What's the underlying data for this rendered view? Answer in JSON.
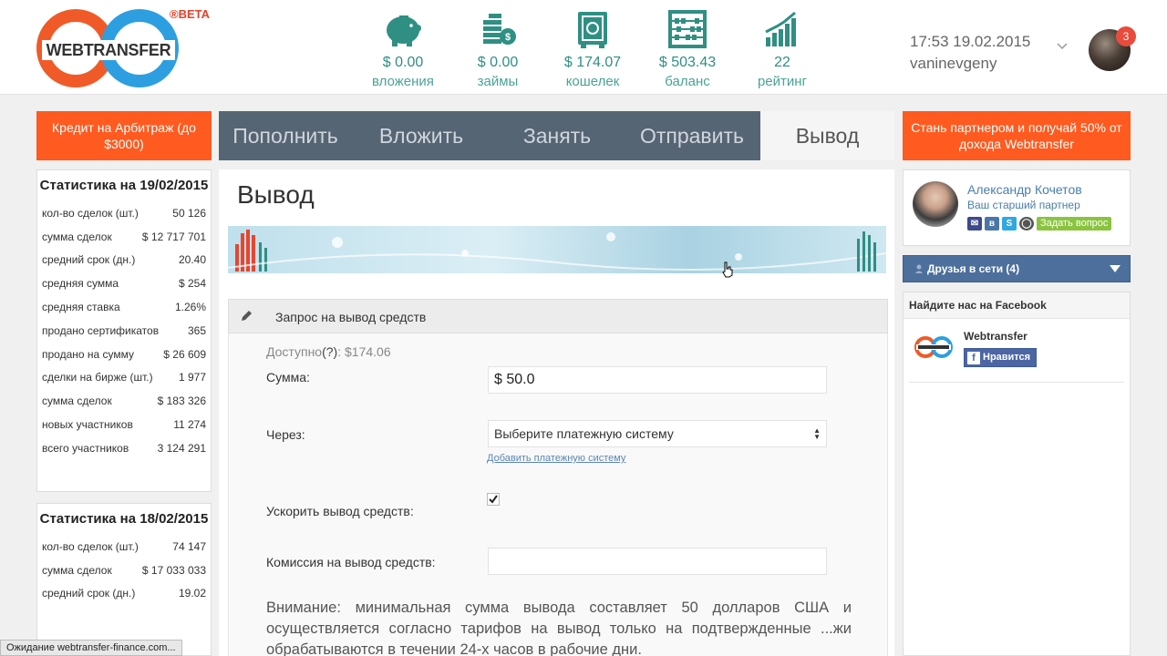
{
  "brand": {
    "logo_text": "WEBTRANSFER",
    "beta": "®BETA"
  },
  "header_stats": [
    {
      "icon": "piggy-bank-icon",
      "value": "$ 0.00",
      "label": "вложения"
    },
    {
      "icon": "coins-icon",
      "value": "$ 0.00",
      "label": "займы"
    },
    {
      "icon": "safe-icon",
      "value": "$ 174.07",
      "label": "кошелек"
    },
    {
      "icon": "abacus-icon",
      "value": "$ 503.43",
      "label": "баланс"
    },
    {
      "icon": "rating-chart-icon",
      "value": "22",
      "label": "рейтинг"
    }
  ],
  "user": {
    "datetime": "17:53 19.02.2015",
    "username": "vaninevgeny",
    "notifications": "3"
  },
  "left_promo": "Кредит на Арбитраж (до $3000)",
  "right_promo": "Стань партнером и получай 50% от дохода Webtransfer",
  "stats_today": {
    "title": "Статистика на 19/02/2015",
    "rows": [
      {
        "label": "кол-во сделок (шт.)",
        "value": "50 126"
      },
      {
        "label": "сумма сделок",
        "value": "$ 12 717 701"
      },
      {
        "label": "средний срок (дн.)",
        "value": "20.40"
      },
      {
        "label": "средняя сумма",
        "value": "$ 254"
      },
      {
        "label": "средняя ставка",
        "value": "1.26%"
      },
      {
        "label": "продано сертификатов",
        "value": "365"
      },
      {
        "label": "продано на сумму",
        "value": "$ 26 609"
      },
      {
        "label": "сделки на бирже (шт.)",
        "value": "1 977"
      },
      {
        "label": "сумма сделок",
        "value": "$ 183 326"
      },
      {
        "label": "новых участников",
        "value": "11 274"
      },
      {
        "label": "всего участников",
        "value": "3 124 291"
      }
    ]
  },
  "stats_yesterday": {
    "title": "Статистика на 18/02/2015",
    "rows": [
      {
        "label": "кол-во сделок (шт.)",
        "value": "74 147"
      },
      {
        "label": "сумма сделок",
        "value": "$ 17 033 033"
      },
      {
        "label": "средний срок (дн.)",
        "value": "19.02"
      }
    ]
  },
  "tabs": [
    {
      "label": "Пополнить",
      "active": false
    },
    {
      "label": "Вложить",
      "active": false
    },
    {
      "label": "Занять",
      "active": false
    },
    {
      "label": "Отправить",
      "active": false
    },
    {
      "label": "Вывод",
      "active": true
    }
  ],
  "page": {
    "title": "Вывод",
    "form_title": "Запрос на вывод средств",
    "available_label": "Доступно",
    "available_hint": "(?)",
    "available_value": ":  $174.06",
    "amount_label": "Сумма:",
    "amount_value": "$ 50.0",
    "via_label": "Через:",
    "via_selected": "Выберите платежную систему",
    "add_system_link": "Добавить платежную систему",
    "speedup_label": "Ускорить вывод средств:",
    "speedup_checked": true,
    "commission_label": "Комиссия на вывод средств:",
    "commission_value": "",
    "notice": "Внимание: минимальная сумма вывода составляет 50 долларов США и осуществляется согласно тарифов на вывод только на подтвержденные ...жи обрабатываются в течении 24-х часов в рабочие дни."
  },
  "partner": {
    "name": "Александр Кочетов",
    "role": "Ваш старший партнер",
    "icons": [
      "email-icon",
      "vk-icon",
      "skype-icon",
      "odnoklassniki-icon"
    ],
    "ask_button": "Задать вопрос"
  },
  "friends": {
    "label": "Друзья в сети (4)"
  },
  "facebook": {
    "header": "Найдите нас на Facebook",
    "page_name": "Webtransfer",
    "like_label": "Нравится"
  },
  "status_bar": "Ожидание webtransfer-finance.com...",
  "colors": {
    "teal": "#2f8f83",
    "orange": "#ff5a1f",
    "tabs_bg": "#566574",
    "link_blue": "#4a7fa9"
  }
}
